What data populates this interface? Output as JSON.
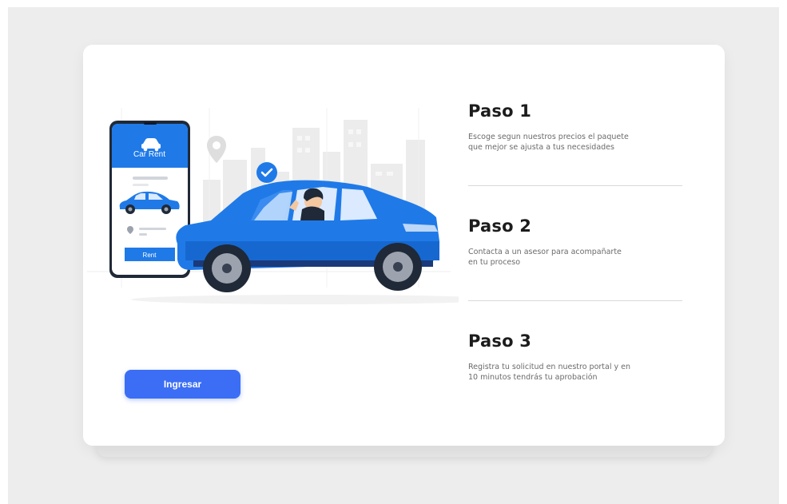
{
  "phone": {
    "brand": "Car Rent",
    "rent_label": "Rent"
  },
  "cta": {
    "label": "Ingresar"
  },
  "steps": [
    {
      "title": "Paso 1",
      "description": "Escoge segun nuestros precios el paquete que mejor se ajusta a tus necesidades"
    },
    {
      "title": "Paso 2",
      "description": "Contacta a un asesor para acompañarte en tu proceso"
    },
    {
      "title": "Paso 3",
      "description": "Registra tu solicitud en nuestro portal y en 10 minutos tendrás tu aprobación"
    }
  ],
  "colors": {
    "accent": "#3b6ef5",
    "car_blue": "#1f7ae8",
    "background": "#ededed",
    "card": "#ffffff"
  },
  "icons": [
    "car-icon",
    "location-pin-icon",
    "check-badge-icon"
  ]
}
